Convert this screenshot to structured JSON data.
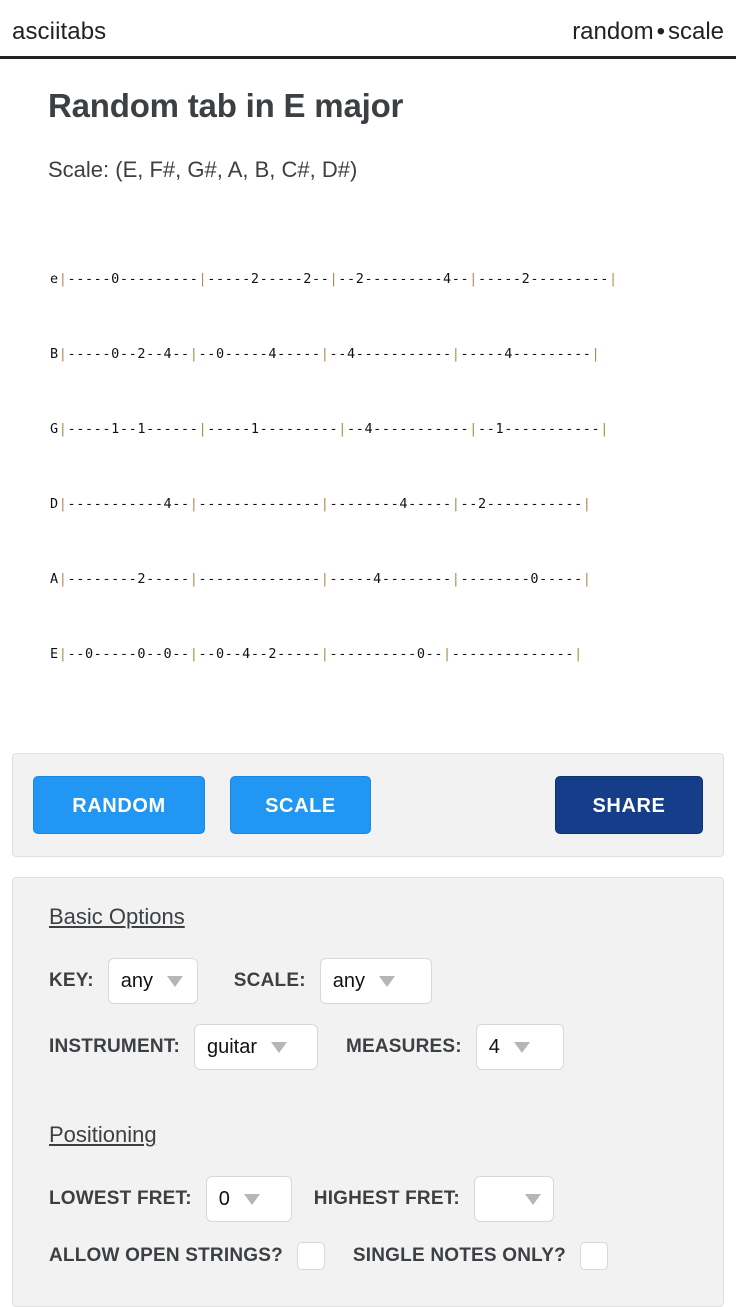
{
  "header": {
    "brand": "asciitabs",
    "nav": {
      "random": "random",
      "separator": "•",
      "scale": "scale"
    }
  },
  "main": {
    "title": "Random tab in E major",
    "scale_line": "Scale: (E, F#, G#, A, B, C#, D#)"
  },
  "tab": {
    "bar_color": "#b08b4f",
    "rows": [
      {
        "label": "e",
        "content": "|-----0---------|-----2-----2--|--2---------4--|-----2---------|"
      },
      {
        "label": "B",
        "content": "|-----0--2--4--|--0-----4-----|--4-----------|-----4---------|"
      },
      {
        "label": "G",
        "content": "|-----1--1------|-----1---------|--4-----------|--1-----------|"
      },
      {
        "label": "D",
        "content": "|-----------4--|--------------|--------4-----|--2-----------|"
      },
      {
        "label": "A",
        "content": "|--------2-----|--------------|-----4--------|--------0-----|"
      },
      {
        "label": "E",
        "content": "|--0-----0--0--|--0--4--2-----|----------0--|--------------|"
      }
    ]
  },
  "actions": {
    "random_label": "RANDOM",
    "scale_label": "SCALE",
    "share_label": "SHARE",
    "primary_color": "#2196f3",
    "share_color": "#153d8a"
  },
  "options": {
    "basic_title": "Basic Options",
    "positioning_title": "Positioning",
    "key": {
      "label": "KEY:",
      "value": "any"
    },
    "scale": {
      "label": "SCALE:",
      "value": "any"
    },
    "instrument": {
      "label": "INSTRUMENT:",
      "value": "guitar"
    },
    "measures": {
      "label": "MEASURES:",
      "value": "4"
    },
    "lowest_fret": {
      "label": "LOWEST FRET:",
      "value": "0"
    },
    "highest_fret": {
      "label": "HIGHEST FRET:",
      "value": ""
    },
    "allow_open_strings": {
      "label": "ALLOW OPEN STRINGS?",
      "checked": false
    },
    "single_notes_only": {
      "label": "SINGLE NOTES ONLY?",
      "checked": false
    }
  }
}
